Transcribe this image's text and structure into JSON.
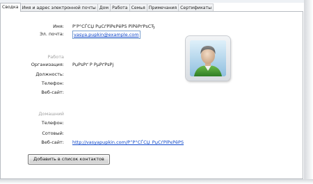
{
  "tabs": [
    {
      "label": "Сводка",
      "active": true
    },
    {
      "label": "Имя и адрес электронной почты",
      "active": false
    },
    {
      "label": "Дом",
      "active": false
    },
    {
      "label": "Работа",
      "active": false
    },
    {
      "label": "Семья",
      "active": false
    },
    {
      "label": "Примечания",
      "active": false
    },
    {
      "label": "Сертификаты",
      "active": false
    }
  ],
  "summary": {
    "name_label": "Имя:",
    "name_value": "Р’Р°СЃСЏ РџСѓРїРєРёРЅ РїРёРґРѕСЂ",
    "email_label": "Эл. почта:",
    "email_value": "vasya.pupkin@example.com",
    "work_section": "Работа",
    "org_label": "Организация:",
    "org_value": "РџРѕРґ Р РµРґРѕРј",
    "position_label": "Должность:",
    "position_value": "",
    "work_phone_label": "Телефон:",
    "work_phone_value": "",
    "work_website_label": "Веб-сайт:",
    "work_website_value": "",
    "home_section": "Домашний",
    "home_phone_label": "Телефон:",
    "home_phone_value": "",
    "mobile_label": "Сотовый:",
    "mobile_value": "",
    "home_website_label": "Веб-сайт:",
    "home_website_value": "http://vasyapupkin.com/Р”Р°СЃСЏ_РџСѓРїРєРёРЅ"
  },
  "avatar": {
    "icon": "contact-user-icon"
  },
  "add_button_label": "Добавить в список контактов",
  "colors": {
    "link": "#0a44c9",
    "section_label": "#a2a2a2",
    "email_focus_border": "#7da2ce"
  }
}
